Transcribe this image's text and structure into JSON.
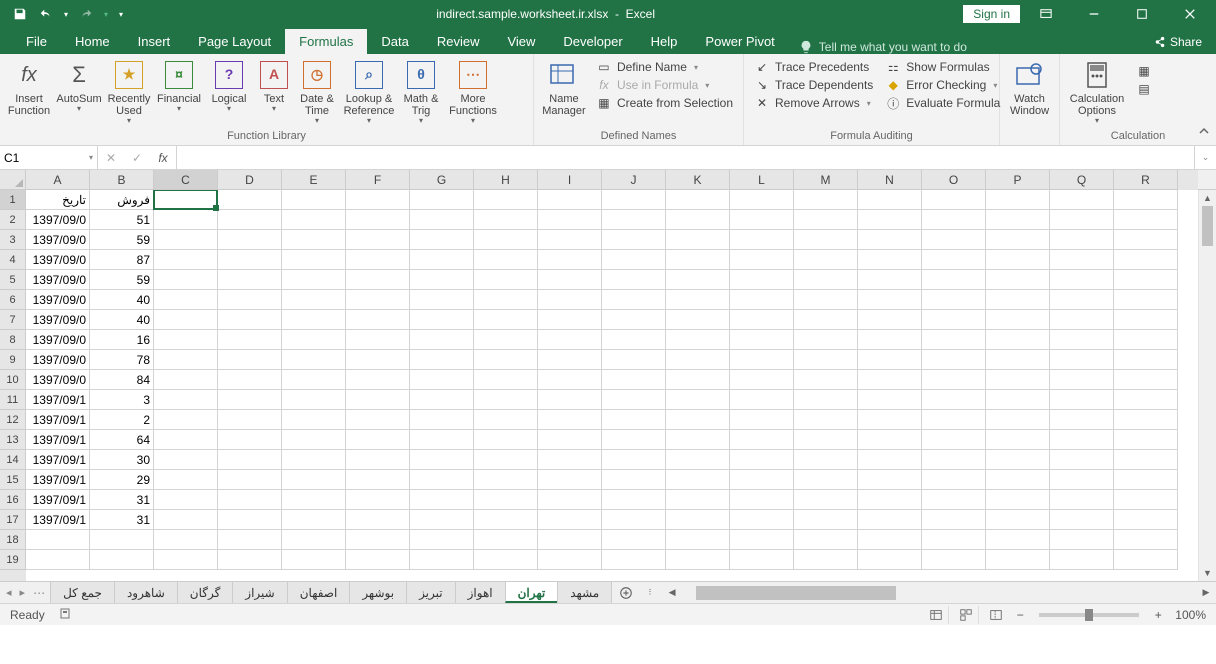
{
  "title": {
    "doc": "indirect.sample.worksheet.ir.xlsx",
    "app": "Excel"
  },
  "signin": "Sign in",
  "tabs": {
    "file": "File",
    "home": "Home",
    "insert": "Insert",
    "pageLayout": "Page Layout",
    "formulas": "Formulas",
    "data": "Data",
    "review": "Review",
    "view": "View",
    "developer": "Developer",
    "help": "Help",
    "powerPivot": "Power Pivot",
    "tellme": "Tell me what you want to do",
    "share": "Share"
  },
  "ribbon": {
    "insertFunction": "Insert\nFunction",
    "autoSum": "AutoSum",
    "recentlyUsed": "Recently\nUsed",
    "financial": "Financial",
    "logical": "Logical",
    "text": "Text",
    "dateTime": "Date &\nTime",
    "lookupRef": "Lookup &\nReference",
    "mathTrig": "Math &\nTrig",
    "moreFunctions": "More\nFunctions",
    "functionLibrary": "Function Library",
    "nameManager": "Name\nManager",
    "defineName": "Define Name",
    "useInFormula": "Use in Formula",
    "createFromSelection": "Create from Selection",
    "definedNames": "Defined Names",
    "tracePrecedents": "Trace Precedents",
    "traceDependents": "Trace Dependents",
    "removeArrows": "Remove Arrows",
    "showFormulas": "Show Formulas",
    "errorChecking": "Error Checking",
    "evaluateFormula": "Evaluate Formula",
    "formulaAuditing": "Formula Auditing",
    "watchWindow": "Watch\nWindow",
    "calcOptions": "Calculation\nOptions",
    "calculation": "Calculation"
  },
  "namebox": "C1",
  "columns": [
    "A",
    "B",
    "C",
    "D",
    "E",
    "F",
    "G",
    "H",
    "I",
    "J",
    "K",
    "L",
    "M",
    "N",
    "O",
    "P",
    "Q",
    "R"
  ],
  "selectedCell": {
    "row": 1,
    "colIndex": 2
  },
  "data_rows": [
    [
      "تاریخ",
      "فروش"
    ],
    [
      "1397/09/0",
      "51"
    ],
    [
      "1397/09/0",
      "59"
    ],
    [
      "1397/09/0",
      "87"
    ],
    [
      "1397/09/0",
      "59"
    ],
    [
      "1397/09/0",
      "40"
    ],
    [
      "1397/09/0",
      "40"
    ],
    [
      "1397/09/0",
      "16"
    ],
    [
      "1397/09/0",
      "78"
    ],
    [
      "1397/09/0",
      "84"
    ],
    [
      "1397/09/1",
      "3"
    ],
    [
      "1397/09/1",
      "2"
    ],
    [
      "1397/09/1",
      "64"
    ],
    [
      "1397/09/1",
      "30"
    ],
    [
      "1397/09/1",
      "29"
    ],
    [
      "1397/09/1",
      "31"
    ],
    [
      "1397/09/1",
      "31"
    ]
  ],
  "visibleRows": 19,
  "sheets": [
    "جمع کل",
    "شاهرود",
    "گرگان",
    "شیراز",
    "اصفهان",
    "بوشهر",
    "تبریز",
    "اهواز",
    "تهران",
    "مشهد"
  ],
  "activeSheetIndex": 8,
  "status": {
    "ready": "Ready",
    "zoom": "100%"
  }
}
